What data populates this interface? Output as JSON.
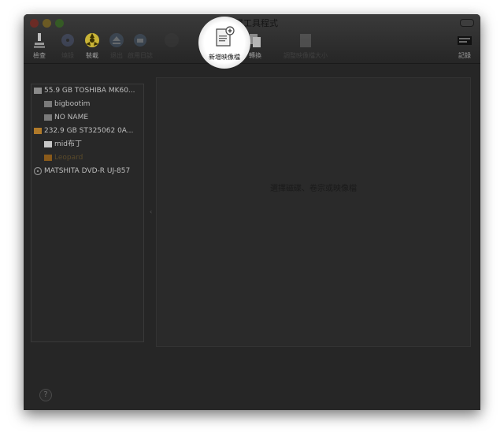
{
  "window": {
    "title": "磁碟工具程式"
  },
  "toolbar": {
    "items": [
      {
        "label": "檢查",
        "icon": "microscope-icon"
      },
      {
        "label": "燒錄",
        "icon": "burn-icon"
      },
      {
        "label": "裝載",
        "icon": "mount-icon"
      },
      {
        "label": "退出",
        "icon": "eject-icon"
      },
      {
        "label": "啟用日誌",
        "icon": "enable-journaling-icon"
      },
      {
        "label": "新增映像檔",
        "icon": "new-image-icon"
      },
      {
        "label": "轉換",
        "icon": "convert-icon"
      },
      {
        "label": "調整映像檔大小",
        "icon": "resize-image-icon"
      },
      {
        "label": "記錄",
        "icon": "log-icon"
      }
    ]
  },
  "sidebar": {
    "items": [
      {
        "label": "55.9 GB TOSHIBA MK60...",
        "level": 0,
        "icon": "hard-drive-icon"
      },
      {
        "label": "bigbootim",
        "level": 1,
        "icon": "volume-icon"
      },
      {
        "label": "NO NAME",
        "level": 1,
        "icon": "volume-icon"
      },
      {
        "label": "232.9 GB ST325062 0A...",
        "level": 0,
        "icon": "external-drive-icon"
      },
      {
        "label": "mid布丁",
        "level": 1,
        "icon": "volume-icon"
      },
      {
        "label": "Leopard",
        "level": 1,
        "icon": "volume-icon"
      },
      {
        "label": "MATSHITA DVD-R UJ-857",
        "level": 0,
        "icon": "optical-drive-icon"
      }
    ]
  },
  "content": {
    "empty_message": "選擇磁碟、卷宗或映像檔"
  },
  "help": {
    "label": "?"
  },
  "colors": {
    "window_bg": "#262626",
    "spotlight": "#ffffff"
  }
}
